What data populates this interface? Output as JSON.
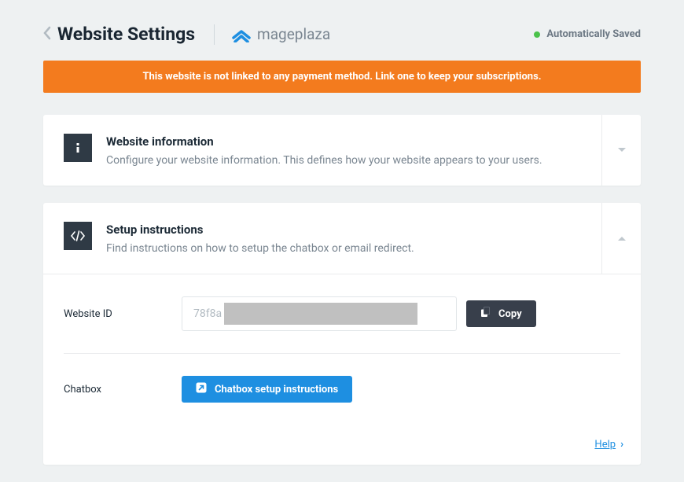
{
  "header": {
    "title": "Website Settings",
    "brand_name": "mageplaza",
    "status": "Automatically Saved"
  },
  "warning": {
    "message": "This website is not linked to any payment method. Link one to keep your subscriptions."
  },
  "panel_info": {
    "title": "Website information",
    "subtitle": "Configure your website information. This defines how your website appears to your users."
  },
  "panel_setup": {
    "title": "Setup instructions",
    "subtitle": "Find instructions on how to setup the chatbox or email redirect.",
    "field_website_id": {
      "label": "Website ID",
      "value": "78f8a",
      "copy_label": "Copy"
    },
    "field_chatbox": {
      "label": "Chatbox",
      "button_label": "Chatbox setup instructions"
    }
  },
  "footer": {
    "help_label": "Help"
  }
}
